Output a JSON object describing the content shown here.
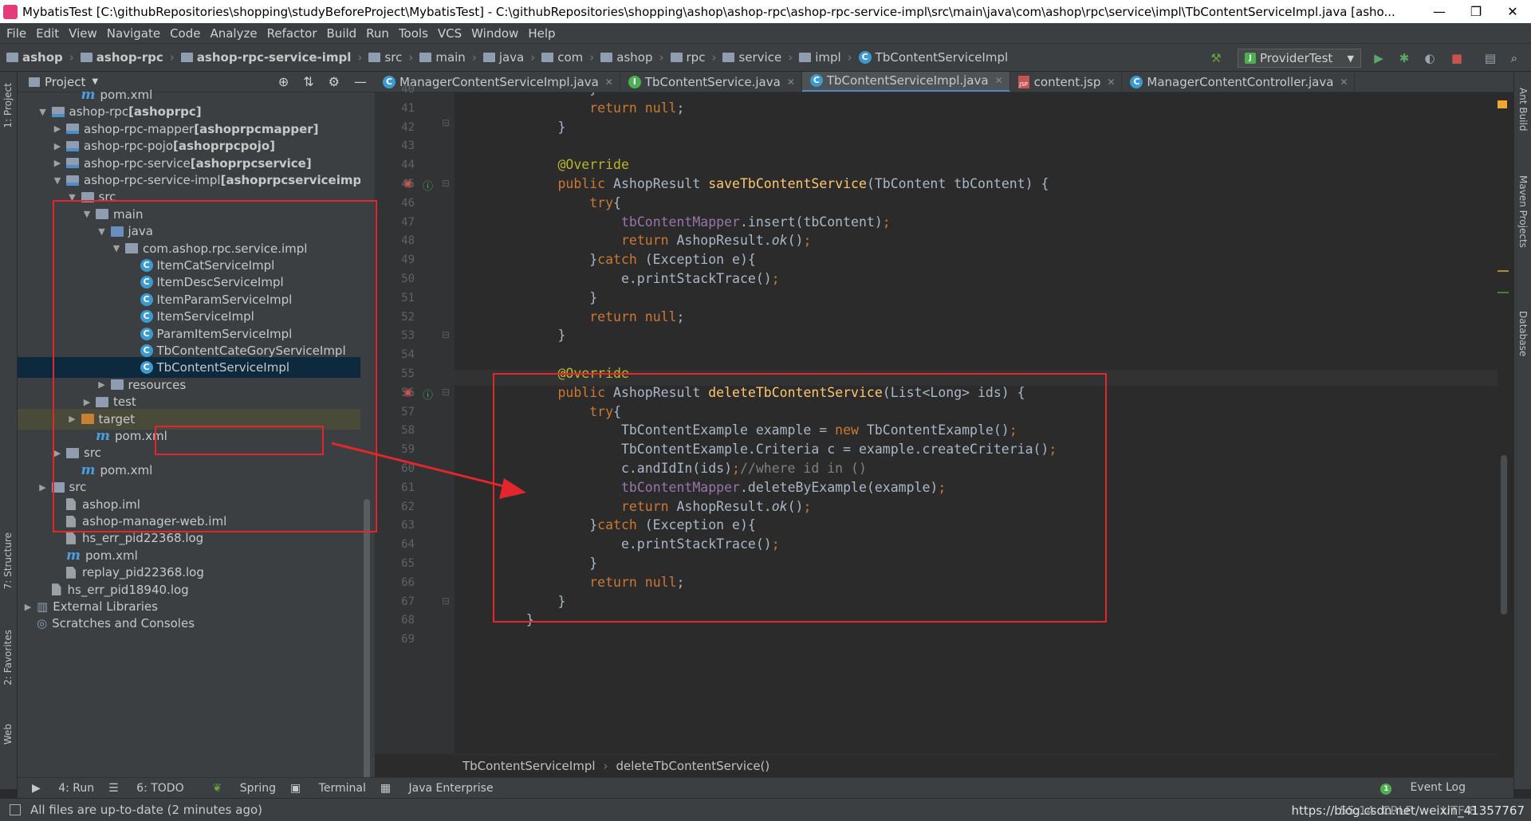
{
  "window": {
    "title": "MybatisTest [C:\\githubRepositories\\shopping\\studyBeforeProject\\MybatisTest] - C:\\githubRepositories\\shopping\\ashop\\ashop-rpc\\ashop-rpc-service-impl\\src\\main\\java\\com\\ashop\\rpc\\service\\impl\\TbContentServiceImpl.java [asho...",
    "minimize": "—",
    "restore": "❐",
    "close": "✕"
  },
  "menu": [
    "File",
    "Edit",
    "View",
    "Navigate",
    "Code",
    "Analyze",
    "Refactor",
    "Build",
    "Run",
    "Tools",
    "VCS",
    "Window",
    "Help"
  ],
  "breadcrumbs": [
    "ashop",
    "ashop-rpc",
    "ashop-rpc-service-impl",
    "src",
    "main",
    "java",
    "com",
    "ashop",
    "rpc",
    "service",
    "impl",
    "TbContentServiceImpl"
  ],
  "run_config": "ProviderTest",
  "left_tools": [
    "1: Project",
    "7: Structure",
    "2: Favorites",
    "Web"
  ],
  "right_tools": [
    "Ant Build",
    "Maven Projects",
    "Database"
  ],
  "project": {
    "header": "Project",
    "rows": [
      {
        "label": "pom.xml",
        "kind": "maven",
        "indent": 3,
        "arrow": ""
      },
      {
        "label": "ashop-rpc [ashoprpc]",
        "kind": "module",
        "indent": 1,
        "arrow": "▼",
        "boldpart": "[ashoprpc]",
        "plain": "ashop-rpc "
      },
      {
        "label": "ashop-rpc-mapper [ashoprpcmapper]",
        "kind": "module",
        "indent": 2,
        "arrow": "▶",
        "plain": "ashop-rpc-mapper ",
        "boldpart": "[ashoprpcmapper]"
      },
      {
        "label": "ashop-rpc-pojo [ashoprpcpojo]",
        "kind": "module",
        "indent": 2,
        "arrow": "▶",
        "plain": "ashop-rpc-pojo ",
        "boldpart": "[ashoprpcpojo]"
      },
      {
        "label": "ashop-rpc-service [ashoprpcservice]",
        "kind": "module",
        "indent": 2,
        "arrow": "▶",
        "plain": "ashop-rpc-service ",
        "boldpart": "[ashoprpcservice]"
      },
      {
        "label": "ashop-rpc-service-impl [ashoprpcserviceimpl]",
        "kind": "module",
        "indent": 2,
        "arrow": "▼",
        "plain": "ashop-rpc-service-impl ",
        "boldpart": "[ashoprpcserviceimpl]"
      },
      {
        "label": "src",
        "kind": "folder",
        "indent": 3,
        "arrow": "▼"
      },
      {
        "label": "main",
        "kind": "folder",
        "indent": 4,
        "arrow": "▼"
      },
      {
        "label": "java",
        "kind": "src",
        "indent": 5,
        "arrow": "▼"
      },
      {
        "label": "com.ashop.rpc.service.impl",
        "kind": "pkg",
        "indent": 6,
        "arrow": "▼"
      },
      {
        "label": "ItemCatServiceImpl",
        "kind": "class",
        "indent": 7,
        "arrow": ""
      },
      {
        "label": "ItemDescServiceImpl",
        "kind": "class",
        "indent": 7,
        "arrow": ""
      },
      {
        "label": "ItemParamServiceImpl",
        "kind": "class",
        "indent": 7,
        "arrow": ""
      },
      {
        "label": "ItemServiceImpl",
        "kind": "class",
        "indent": 7,
        "arrow": ""
      },
      {
        "label": "ParamItemServiceImpl",
        "kind": "class",
        "indent": 7,
        "arrow": ""
      },
      {
        "label": "TbContentCateGoryServiceImpl",
        "kind": "class",
        "indent": 7,
        "arrow": ""
      },
      {
        "label": "TbContentServiceImpl",
        "kind": "class",
        "indent": 7,
        "arrow": "",
        "selected": true
      },
      {
        "label": "resources",
        "kind": "folder",
        "indent": 5,
        "arrow": "▶"
      },
      {
        "label": "test",
        "kind": "folder",
        "indent": 4,
        "arrow": "▶"
      },
      {
        "label": "target",
        "kind": "orange",
        "indent": 3,
        "arrow": "▶",
        "hl": true
      },
      {
        "label": "pom.xml",
        "kind": "maven",
        "indent": 4,
        "arrow": ""
      },
      {
        "label": "src",
        "kind": "folder",
        "indent": 2,
        "arrow": "▶"
      },
      {
        "label": "pom.xml",
        "kind": "maven",
        "indent": 3,
        "arrow": ""
      },
      {
        "label": "src",
        "kind": "folder",
        "indent": 1,
        "arrow": "▶"
      },
      {
        "label": "ashop.iml",
        "kind": "file",
        "indent": 2,
        "arrow": ""
      },
      {
        "label": "ashop-manager-web.iml",
        "kind": "file",
        "indent": 2,
        "arrow": ""
      },
      {
        "label": "hs_err_pid22368.log",
        "kind": "file",
        "indent": 2,
        "arrow": ""
      },
      {
        "label": "pom.xml",
        "kind": "maven",
        "indent": 2,
        "arrow": ""
      },
      {
        "label": "replay_pid22368.log",
        "kind": "file",
        "indent": 2,
        "arrow": ""
      },
      {
        "label": "hs_err_pid18940.log",
        "kind": "file",
        "indent": 1,
        "arrow": ""
      },
      {
        "label": "External Libraries",
        "kind": "lib",
        "indent": 0,
        "arrow": "▶"
      },
      {
        "label": "Scratches and Consoles",
        "kind": "scratch",
        "indent": 0,
        "arrow": ""
      }
    ]
  },
  "tabs": [
    {
      "label": "ManagerContentServiceImpl.java",
      "icon": "class",
      "active": false
    },
    {
      "label": "TbContentService.java",
      "icon": "interface",
      "active": false
    },
    {
      "label": "TbContentServiceImpl.java",
      "icon": "class",
      "active": true
    },
    {
      "label": "content.jsp",
      "icon": "jsp",
      "active": false
    },
    {
      "label": "ManagerContentController.java",
      "icon": "class",
      "active": false
    }
  ],
  "code_lines": [
    {
      "n": "40",
      "html": "            }"
    },
    {
      "n": "41",
      "html": "            <span class=\"kw\">return null</span>;"
    },
    {
      "n": "42",
      "html": "        }"
    },
    {
      "n": "43",
      "html": ""
    },
    {
      "n": "44",
      "html": "        <span class=\"an\">@Override</span>"
    },
    {
      "n": "45",
      "html": "        <span class=\"kw\">public </span>AshopResult <span class=\"fn\">saveTbContentService</span>(TbContent tbContent) {"
    },
    {
      "n": "46",
      "html": "            <span class=\"kw\">try</span>{"
    },
    {
      "n": "47",
      "html": "                <span class=\"fld\">tbContentMapper</span>.insert(tbContent)<span class=\"kw\">;</span>"
    },
    {
      "n": "48",
      "html": "                <span class=\"kw\">return </span>AshopResult.<span class=\"it\">ok</span>()<span class=\"kw\">;</span>"
    },
    {
      "n": "49",
      "html": "            }<span class=\"kw\">catch </span>(Exception e){"
    },
    {
      "n": "50",
      "html": "                e.printStackTrace()<span class=\"kw\">;</span>"
    },
    {
      "n": "51",
      "html": "            }"
    },
    {
      "n": "52",
      "html": "            <span class=\"kw\">return null</span>;"
    },
    {
      "n": "53",
      "html": "        }"
    },
    {
      "n": "54",
      "html": ""
    },
    {
      "n": "55",
      "html": "        <span class=\"an\">@Override</span>"
    },
    {
      "n": "56",
      "html": "        <span class=\"kw\">public </span>AshopResult <span class=\"fn\">deleteTbContentService</span>(List&lt;Long&gt; ids) {"
    },
    {
      "n": "57",
      "html": "            <span class=\"kw\">try</span>{"
    },
    {
      "n": "58",
      "html": "                TbContentExample example = <span class=\"kw\">new </span>TbContentExample()<span class=\"kw\">;</span>"
    },
    {
      "n": "59",
      "html": "                TbContentExample.Criteria c = example.createCriteria()<span class=\"kw\">;</span>"
    },
    {
      "n": "60",
      "html": "                c.andIdIn(ids)<span class=\"kw\">;</span><span class=\"cm\">//where id in ()</span>"
    },
    {
      "n": "61",
      "html": "                <span class=\"fld\">tbContentMapper</span>.deleteByExample(example)<span class=\"kw\">;</span>"
    },
    {
      "n": "62",
      "html": "                <span class=\"kw\">return </span>AshopResult.<span class=\"it\">ok</span>()<span class=\"kw\">;</span>"
    },
    {
      "n": "63",
      "html": "            }<span class=\"kw\">catch </span>(Exception e){"
    },
    {
      "n": "64",
      "html": "                e.printStackTrace()<span class=\"kw\">;</span>"
    },
    {
      "n": "65",
      "html": "            }"
    },
    {
      "n": "66",
      "html": "            <span class=\"kw\">return null</span>;"
    },
    {
      "n": "67",
      "html": "        }"
    },
    {
      "n": "68",
      "html": "    }"
    },
    {
      "n": "69",
      "html": ""
    }
  ],
  "editor_breadcrumb": [
    "TbContentServiceImpl",
    "deleteTbContentService()"
  ],
  "bottom_tools": [
    "4: Run",
    "6: TODO",
    "Spring",
    "Terminal",
    "Java Enterprise"
  ],
  "event_log": "Event Log",
  "status": {
    "message": "All files are up-to-date (2 minutes ago)",
    "position": "55:14",
    "line_sep": "CRLF",
    "encoding": "UTF-8",
    "watermark": "https://blog.csdn.net/weixin_41357767"
  },
  "colors": {
    "keyword": "#cc7832",
    "annotation": "#bbb529",
    "method": "#ffc66d",
    "field": "#9876aa",
    "highlight_box": "#e3262c"
  }
}
